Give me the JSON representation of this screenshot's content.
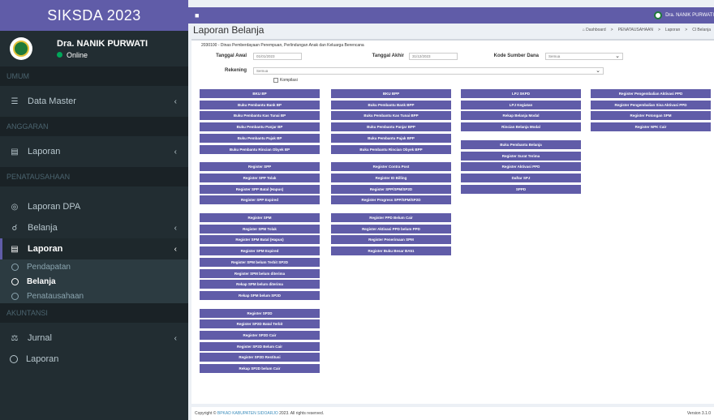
{
  "brand": "SIKSDA 2023",
  "user": {
    "name": "Dra. NANIK PURWATI",
    "status": "Online"
  },
  "topbar": {
    "menu_icon": "hamburger-icon",
    "user_label": "Dra. NANIK PURWATI"
  },
  "sidebar": {
    "headers": [
      "UMUM",
      "ANGGARAN",
      "PENATAUSAHAAN",
      "AKUNTANSI"
    ],
    "data_master": "Data Master",
    "laporan_anggaran": "Laporan",
    "laporan_dpa": "Laporan DPA",
    "belanja": "Belanja",
    "laporan_penata": "Laporan",
    "sub_items": [
      "Pendapatan",
      "Belanja",
      "Penatausahaan"
    ],
    "jurnal": "Jurnal",
    "laporan_akuntansi": "Laporan"
  },
  "page": {
    "title": "Laporan Belanja",
    "breadcrumb": [
      "Dashboard",
      ">",
      "PENATAUSAHAAN",
      ">",
      "Laporan",
      ">",
      "Cl Belanja"
    ],
    "org": "2030100 - Dinas Pemberdayaan Perempuan, Perlindungan Anak dan Keluarga Berencana"
  },
  "filters": {
    "tanggal_awal_label": "Tanggal Awal",
    "tanggal_awal_value": "01/01/2023",
    "tanggal_akhir_label": "Tanggal Akhir",
    "tanggal_akhir_value": "31/12/2023",
    "kode_label": "Kode Sumber Dana",
    "kode_value": "Semua",
    "rekening_label": "Rekening",
    "rekening_value": "Semua",
    "komplikasi_label": "Kompilasi"
  },
  "columns": [
    {
      "groups": [
        [
          "BKU BP",
          "Buku Pembantu Bank BP",
          "Buku Pembantu Kas Tunai BP",
          "Buku Pembantu Panjar BP",
          "Buku Pembantu Pajak BP",
          "Buku Pembantu Rincian Obyek BP"
        ],
        [
          "Register SPP",
          "Register SPP Tolak",
          "Register SPP Batal (Hapus)",
          "Register SPP Expired"
        ],
        [
          "Register SPM",
          "Register SPM Tolak",
          "Register SPM Batal (Hapus)",
          "Register SPM Expired",
          "Register SPM belum Terbit SP2D",
          "Register SPM belum diterima",
          "Rekap SPM belum diterima",
          "Rekap SPM belum SP2D"
        ],
        [
          "Register SP2D",
          "Register SP2D Batal Terbit",
          "Register SP2D Cair",
          "Register SP2D Belum Cair",
          "Register SP2D Restitusi",
          "Rekap SP2D belum Cair"
        ]
      ]
    },
    {
      "groups": [
        [
          "BKU BPP",
          "Buku Pembantu Bank BPP",
          "Buku Pembantu Kas Tunai BPP",
          "Buku Pembantu Panjar BPP",
          "Buku Pembantu Pajak BPP",
          "Buku Pembantu Rincian Obyek BPP"
        ],
        [
          "Register Contra Post",
          "Register ID Billing",
          "Register SPP/SPM/SP2D",
          "Register Progress SPP/SPM/SP2D"
        ],
        [
          "Register PPD Belum Cair",
          "Register Aktivasi PPD belum PPD",
          "Register Penerimaan SPM",
          "Register Buku Besar BA51"
        ]
      ]
    },
    {
      "groups": [
        [
          "LPJ SKPD",
          "LPJ Kegiatan",
          "Rekap Belanja Modal",
          "Rincian Belanja Modal"
        ],
        [
          "Buku Pembantu Belanja",
          "Register Surat Terima",
          "Register Aktivasi PPD",
          "Daftar SPJ",
          "SPPD"
        ]
      ]
    },
    {
      "groups": [
        [
          "Register Pengembalian Aktivasi PPD",
          "Register Pengembalian Sisa Aktivasi PPD",
          "Register Potongan SPM",
          "Register NPK Cair"
        ]
      ]
    }
  ],
  "footer": {
    "copyright": "Copyright © ",
    "org_link": "BPKAD KABUPATEN SIDOARJO",
    "rights": " 2023. All rights reserved.",
    "version": "Version 3.1.0"
  },
  "colors": {
    "brand": "#605ca8",
    "sidebar": "#222d32"
  }
}
